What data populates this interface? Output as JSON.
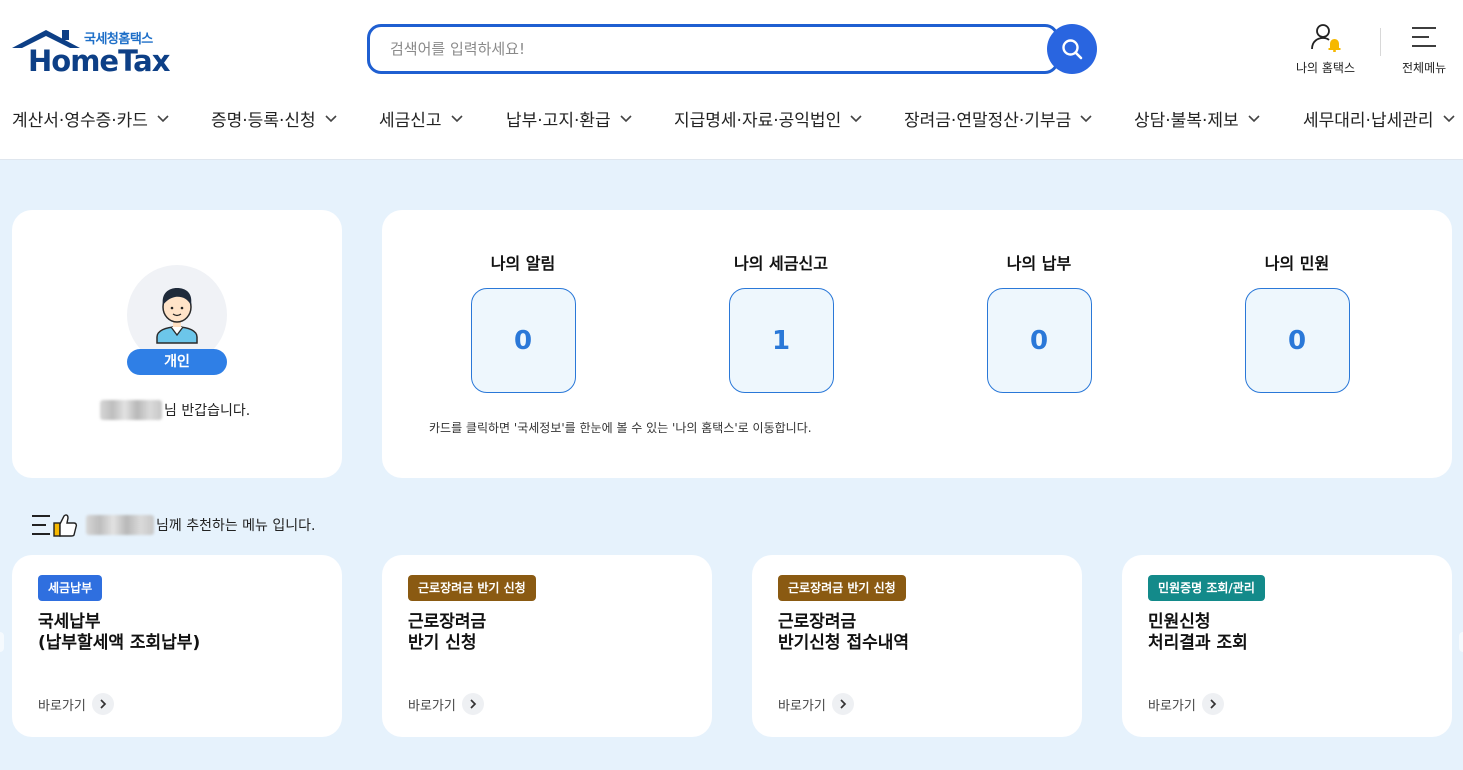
{
  "brand": {
    "sub": "국세청홈택스",
    "main": "HomeTax"
  },
  "search": {
    "placeholder": "검색어를 입력하세요!"
  },
  "top_icons": {
    "my_hometax": "나의 홈택스",
    "all_menu": "전체메뉴"
  },
  "gnb": [
    "계산서·영수증·카드",
    "증명·등록·신청",
    "세금신고",
    "납부·고지·환급",
    "지급명세·자료·공익법인",
    "장려금·연말정산·기부금",
    "상담·불복·제보",
    "세무대리·납세관리"
  ],
  "profile": {
    "badge": "개인",
    "greeting_suffix": "님 반갑습니다."
  },
  "stats": {
    "items": [
      {
        "title": "나의 알림",
        "value": "0"
      },
      {
        "title": "나의 세금신고",
        "value": "1"
      },
      {
        "title": "나의 납부",
        "value": "0"
      },
      {
        "title": "나의 민원",
        "value": "0"
      }
    ],
    "note": "카드를 클릭하면 '국세정보'를 한눈에 볼 수 있는 '나의 홈택스'로 이동합니다."
  },
  "recommend": {
    "suffix": "님께 추천하는 메뉴 입니다."
  },
  "menu_cards": [
    {
      "tag": "세금납부",
      "tag_color": "#2f6fdf",
      "line1": "국세납부",
      "line2": "(납부할세액 조회납부)",
      "go": "바로가기"
    },
    {
      "tag": "근로장려금 반기 신청",
      "tag_color": "#8a5a12",
      "line1": "근로장려금",
      "line2": "반기 신청",
      "go": "바로가기"
    },
    {
      "tag": "근로장려금 반기 신청",
      "tag_color": "#8a5a12",
      "line1": "근로장려금",
      "line2": "반기신청 접수내역",
      "go": "바로가기"
    },
    {
      "tag": "민원증명 조회/관리",
      "tag_color": "#138a8a",
      "line1": "민원신청",
      "line2": "처리결과 조회",
      "go": "바로가기"
    }
  ]
}
